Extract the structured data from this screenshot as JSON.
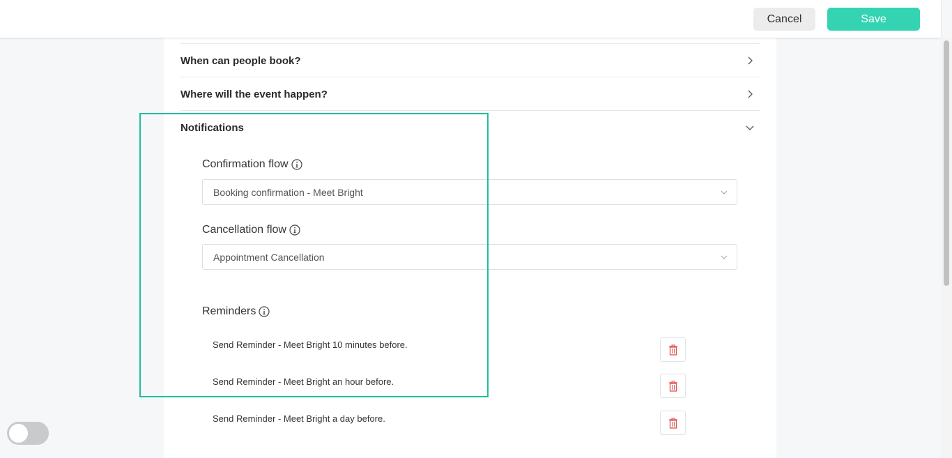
{
  "header": {
    "cancel_label": "Cancel",
    "save_label": "Save",
    "save_color": "#34d4b2"
  },
  "sections": {
    "when_title": "When can people book?",
    "where_title": "Where will the event happen?",
    "notifications_title": "Notifications"
  },
  "notifications": {
    "confirmation_label": "Confirmation flow",
    "confirmation_value": "Booking confirmation - Meet Bright",
    "cancellation_label": "Cancellation flow",
    "cancellation_value": "Appointment Cancellation",
    "reminders_label": "Reminders",
    "reminders": [
      "Send Reminder - Meet Bright 10 minutes before.",
      "Send Reminder - Meet Bright an hour before.",
      "Send Reminder - Meet Bright a day before."
    ]
  },
  "icons": {
    "section_collapsed": "chevron-right-icon",
    "section_expanded": "chevron-down-icon",
    "info": "info-icon",
    "delete": "trash-icon"
  },
  "colors": {
    "highlight": "#1fbf99",
    "delete_icon": "#e05252"
  },
  "toggle": {
    "on": false
  }
}
